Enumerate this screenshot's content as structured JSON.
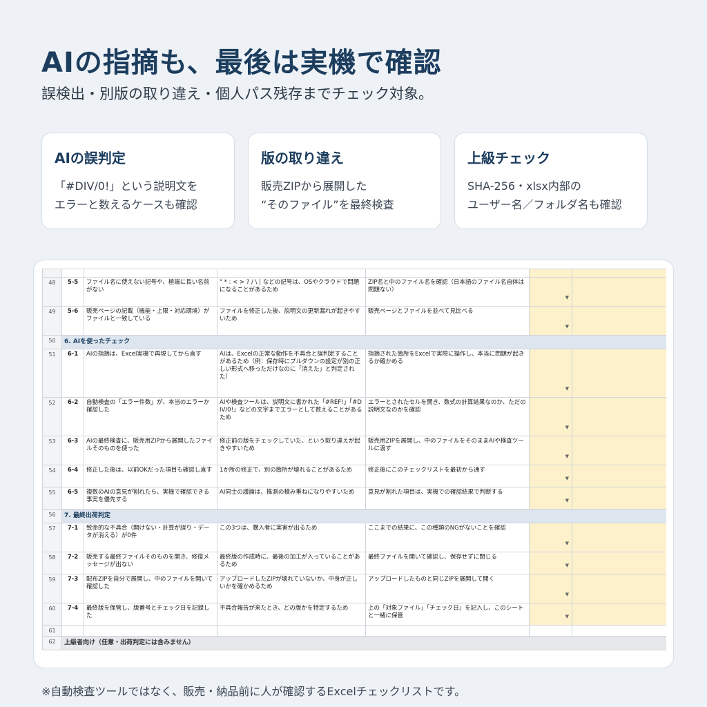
{
  "header": {
    "title": "AIの指摘も、最後は実機で確認",
    "subtitle": "誤検出・別版の取り違え・個人パス残存までチェック対象。"
  },
  "cards": [
    {
      "title": "AIの誤判定",
      "line1": "「#DIV/0!」という説明文を",
      "line2": "エラーと数えるケースも確認"
    },
    {
      "title": "版の取り違え",
      "line1": "販売ZIPから展開した",
      "line2": "“そのファイル”を最終検査"
    },
    {
      "title": "上級チェック",
      "line1": "SHA-256・xlsx内部の",
      "line2": "ユーザー名／フォルダ名も確認"
    }
  ],
  "sheet": {
    "rows": [
      {
        "row": "48",
        "no": "5-5",
        "item": "ファイル名に使えない記号や、極端に長い名前がない",
        "reason": "\" * : < > ? / \\ | などの記号は、OSやクラウドで問題になることがあるため",
        "method": "ZIP名と中のファイル名を確認（日本語のファイル名自体は問題ない）"
      },
      {
        "row": "49",
        "no": "5-6",
        "item": "販売ページの記載（機能・上限・対応環境）がファイルと一致している",
        "reason": "ファイルを修正した後、説明文の更新漏れが起きやすいため",
        "method": "販売ページとファイルを並べて見比べる"
      },
      {
        "row": "50",
        "section": "6. AIを使ったチェック"
      },
      {
        "row": "51",
        "no": "6-1",
        "item": "AIの指摘は、Excel実機で再現してから直す",
        "reason": "AIは、Excelの正常な動作を不具合と誤判定することがあるため（例：保存時にプルダウンの設定が別の正しい形式へ移っただけなのに「消えた」と判定された）",
        "method": "指摘された箇所をExcelで実際に操作し、本当に問題が起きるか確かめる"
      },
      {
        "row": "52",
        "no": "6-2",
        "item": "自動検査の「エラー件数」が、本当のエラーか確認した",
        "reason": "AIや検査ツールは、説明文に書かれた「#REF!」「#DIV/0!」などの文字までエラーとして数えることがあるため",
        "method": "エラーとされたセルを開き、数式の計算結果なのか、ただの説明文なのかを確認"
      },
      {
        "row": "53",
        "no": "6-3",
        "item": "AIの最終検査に、販売用ZIPから展開したファイルそのものを使った",
        "reason": "修正前の版をチェックしていた、という取り違えが起きやすいため",
        "method": "販売用ZIPを展開し、中のファイルをそのままAIや検査ツールに渡す"
      },
      {
        "row": "54",
        "no": "6-4",
        "item": "修正した後は、以前OKだった項目も確認し直す",
        "reason": "1か所の修正で、別の箇所が壊れることがあるため",
        "method": "修正後にこのチェックリストを最初から通す"
      },
      {
        "row": "55",
        "no": "6-5",
        "item": "複数のAIの意見が割れたら、実機で確認できる事実を優先する",
        "reason": "AI同士の議論は、推測の積み重ねになりやすいため",
        "method": "意見が割れた項目は、実機での確認結果で判断する"
      },
      {
        "row": "56",
        "section": "7. 最終出荷判定"
      },
      {
        "row": "57",
        "no": "7-1",
        "item": "致命的な不具合（開けない・計算が誤り・データが消える）が0件",
        "reason": "この3つは、購入者に実害が出るため",
        "method": "ここまでの結果に、この種類のNGがないことを確認"
      },
      {
        "row": "58",
        "no": "7-2",
        "item": "販売する最終ファイルそのものを開き、修復メッセージが出ない",
        "reason": "最終版の作成時に、最後の加工が入っていることがあるため",
        "method": "最終ファイルを開いて確認し、保存せずに閉じる"
      },
      {
        "row": "59",
        "no": "7-3",
        "item": "配布ZIPを自分で展開し、中のファイルを開いて確認した",
        "reason": "アップロードしたZIPが壊れていないか、中身が正しいかを確かめるため",
        "method": "アップロードしたものと同じZIPを展開して開く"
      },
      {
        "row": "60",
        "no": "7-4",
        "item": "最終版を保管し、版番号とチェック日を記録した",
        "reason": "不具合報告が来たとき、どの版かを特定するため",
        "method": "上の「対象ファイル」「チェック日」を記入し、このシートと一緒に保管"
      },
      {
        "row": "61"
      },
      {
        "row": "62",
        "advanced": "上級者向け（任意・出荷判定には含みません）"
      }
    ]
  },
  "footnote": "※自動検査ツールではなく、販売・納品前に人が確認するExcelチェックリストです。",
  "colors": {
    "accent": "#1c3d5e",
    "section_bg": "#dde6ef",
    "input_bg": "#fdf1cc"
  }
}
